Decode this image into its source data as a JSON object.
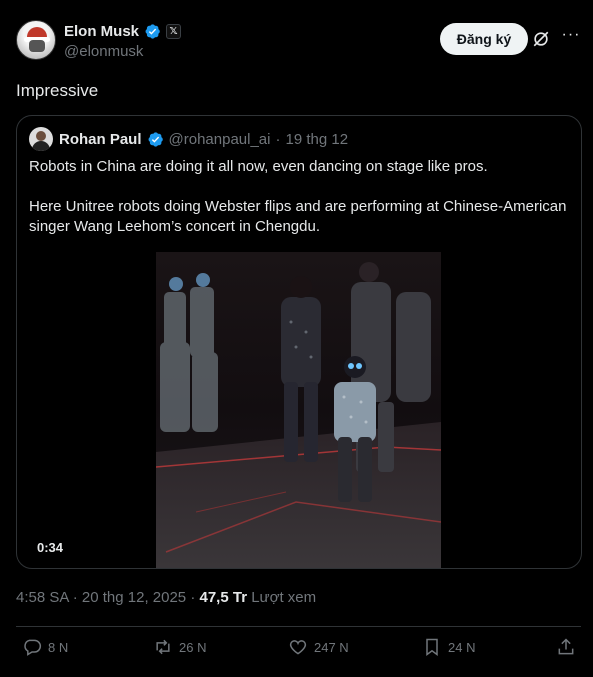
{
  "author": {
    "display_name": "Elon Musk",
    "handle": "@elonmusk",
    "affiliate_badge": "𝕏"
  },
  "header": {
    "subscribe_label": "Đăng ký",
    "more_glyph": "···"
  },
  "tweet": {
    "text": "Impressive",
    "time": "4:58 SA",
    "date": "20 thg 12, 2025",
    "views_count": "47,5 Tr",
    "views_label": "Lượt xem"
  },
  "quote": {
    "display_name": "Rohan Paul",
    "handle": "@rohanpaul_ai",
    "separator": "·",
    "date": "19 thg 12",
    "paragraphs": [
      "Robots in China are doing it all now, even dancing on stage like pros.",
      "Here Unitree robots doing Webster flips and are performing at Chinese-American singer Wang Leehom’s concert in Chengdu."
    ],
    "video_duration": "0:34"
  },
  "actions": {
    "replies": "8 N",
    "reposts": "26 N",
    "likes": "247 N",
    "bookmarks": "24 N"
  },
  "colors": {
    "background": "#000000",
    "text_primary": "#e7e9ea",
    "text_secondary": "#71767b",
    "border": "#2f3336",
    "verified_blue": "#1d9bf0"
  }
}
